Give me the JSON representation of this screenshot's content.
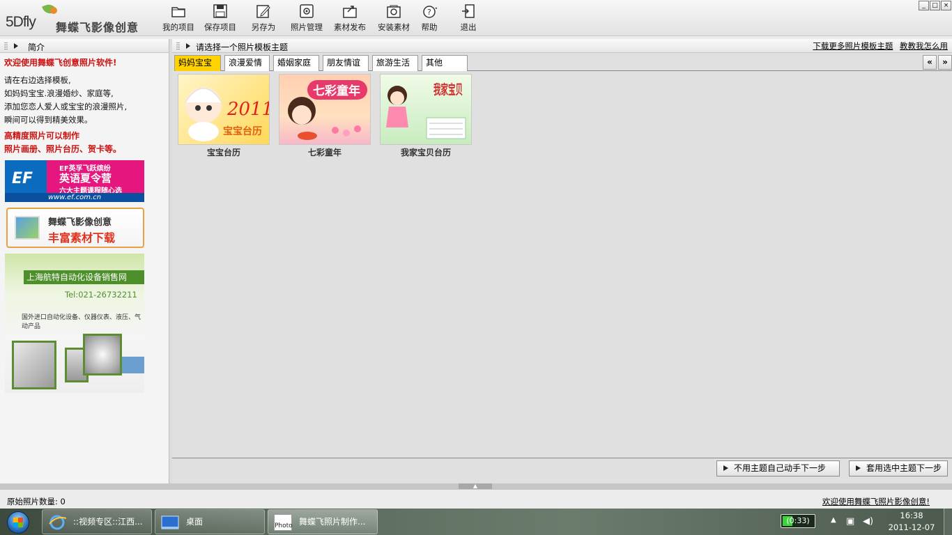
{
  "app": {
    "logo_en": "5Dfly",
    "logo_cn": "舞蝶飞影像创意"
  },
  "toolbar": {
    "items": [
      {
        "label": "我的项目",
        "icon": "folder-open-icon"
      },
      {
        "label": "保存项目",
        "icon": "floppy-save-icon"
      },
      {
        "label": "另存为",
        "icon": "save-as-icon"
      },
      {
        "label": "照片管理",
        "icon": "photo-manage-icon"
      },
      {
        "label": "素材发布",
        "icon": "publish-icon"
      },
      {
        "label": "安装素材",
        "icon": "install-icon"
      },
      {
        "label": "帮助",
        "icon": "help-icon"
      },
      {
        "label": "退出",
        "icon": "exit-icon"
      }
    ]
  },
  "window_controls": [
    "_",
    "□",
    "×"
  ],
  "left_panel": {
    "title": "简介",
    "welcome": "欢迎使用舞蝶飞创意照片软件!",
    "desc": [
      "请在右边选择模板,",
      "如妈妈宝宝.浪漫婚纱、家庭等,",
      "添加您恋人爱人或宝宝的浪漫照片,",
      "瞬间可以得到精美效果。"
    ],
    "highlight": [
      "高精度照片可以制作",
      "照片画册、照片台历、贺卡等。"
    ],
    "ad_ef": {
      "brand": "EF",
      "line1": "EF英孚飞跃缤纷",
      "line2": "英语夏令营",
      "line3": "六大主题课程随心选",
      "url": "www.ef.com.cn"
    },
    "ad_5dfly": {
      "line1": "舞蝶飞影像创意",
      "line2": "丰富素材下载"
    },
    "ad_hangte": {
      "title": "上海航特自动化设备销售网",
      "tel": "Tel:021-26732211",
      "products": "国外进口自动化设备、仪器仪表、液压、气动产品"
    }
  },
  "main": {
    "header": "请选择一个照片模板主题",
    "link_more": "下载更多照片模板主题",
    "link_howto": "教教我怎么用",
    "tabs": [
      "妈妈宝宝",
      "浪漫爱情",
      "婚姻家庭",
      "朋友情谊",
      "旅游生活",
      "其他"
    ],
    "active_tab": 0,
    "nav_prev": "«",
    "nav_next": "»",
    "templates": [
      {
        "caption": "宝宝台历",
        "art_text": "2011",
        "art_sub": "宝宝台历"
      },
      {
        "caption": "七彩童年",
        "art_text": "七彩童年"
      },
      {
        "caption": "我家宝贝台历",
        "art_text": "我家宝贝"
      }
    ],
    "btn_manual": "不用主题自己动手下一步",
    "btn_use_theme": "套用选中主题下一步"
  },
  "status": {
    "left": "原始照片数量: 0",
    "right": "欢迎使用舞蝶飞照片影像创意!"
  },
  "taskbar": {
    "tasks": [
      {
        "label": "::视频专区::江西...",
        "icon": "ie-icon"
      },
      {
        "label": "桌面",
        "icon": "desktop-icon"
      },
      {
        "label": "舞蝶飞照片制作...",
        "icon": "photo-app-icon",
        "icon_text": "Photo"
      }
    ],
    "battery": "(0:33)",
    "time": "16:38",
    "date": "2011-12-07"
  },
  "colors": {
    "active_tab": "#ffd200",
    "red_text": "#cc1111",
    "ef_pink": "#e5167d",
    "hangte_green": "#4d8f2b"
  }
}
